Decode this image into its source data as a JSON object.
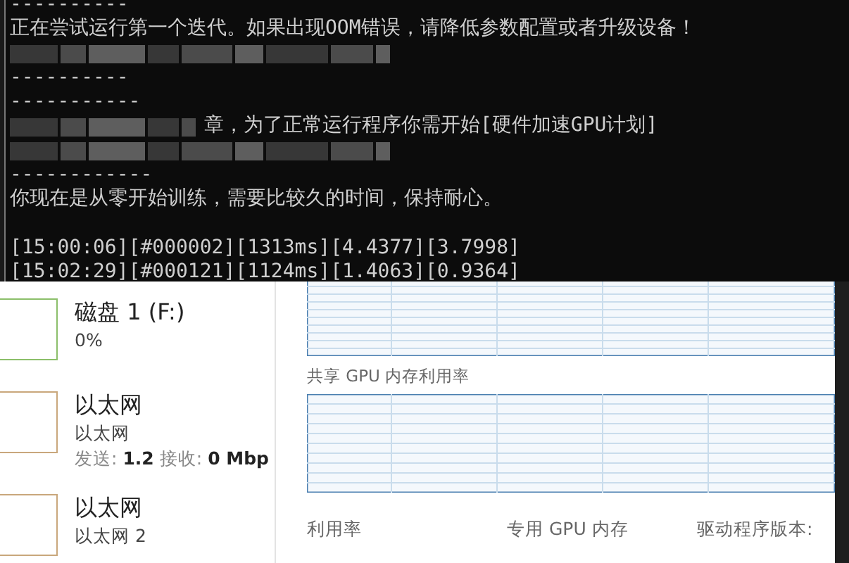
{
  "console": {
    "lines": [
      {
        "kind": "rule",
        "text": "----------"
      },
      {
        "kind": "text",
        "text": "正在尝试运行第一个迭代。如果出现OOM错误，请降低参数配置或者升级设备！"
      },
      {
        "kind": "redacted"
      },
      {
        "kind": "rule",
        "text": "----------"
      },
      {
        "kind": "rule",
        "text": "-----------"
      },
      {
        "kind": "redacted_prefix",
        "text": "章，为了正常运行程序你需开始[硬件加速GPU计划]"
      },
      {
        "kind": "redacted"
      },
      {
        "kind": "rule",
        "text": "------------"
      },
      {
        "kind": "text",
        "text": "你现在是从零开始训练，需要比较久的时间，保持耐心。"
      },
      {
        "kind": "blank"
      },
      {
        "kind": "text",
        "text": "[15:00:06][#000002][1313ms][4.4377][3.7998]"
      },
      {
        "kind": "text",
        "text": "[15:02:29][#000121][1124ms][1.4063][0.9364]"
      }
    ]
  },
  "sidebar": {
    "items": [
      {
        "title": "磁盘 1 (F:)",
        "subtitle": "0%",
        "color": "#8cbf6a"
      },
      {
        "title": "以太网",
        "subtitle": "以太网",
        "color": "#c9a77c",
        "stats": [
          {
            "label": "发送:",
            "value": "1.2"
          },
          {
            "label": "接收:",
            "value": "0 Mbp"
          }
        ]
      },
      {
        "title": "以太网",
        "subtitle": "以太网 2",
        "color": "#c9a77c"
      }
    ]
  },
  "details": {
    "graphs": [
      {
        "kind": "plain"
      },
      {
        "kind": "labeled",
        "label": "共享 GPU 内存利用率"
      }
    ],
    "stat_labels": [
      "利用率",
      "专用 GPU 内存",
      "驱动程序版本:"
    ]
  }
}
